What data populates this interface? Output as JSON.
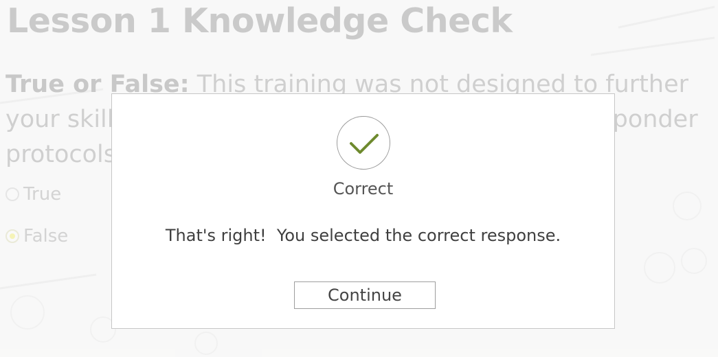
{
  "lesson": {
    "title": "Lesson 1 Knowledge Check"
  },
  "question": {
    "lead": "True or False:",
    "text": " This training was not designed to further your skills and knowledge of client service and responder protocols."
  },
  "options": [
    {
      "label": "True",
      "selected": false
    },
    {
      "label": "False",
      "selected": true
    }
  ],
  "feedback": {
    "icon": "checkmark-icon",
    "title": "Correct",
    "message": "That's right!  You selected the correct response.",
    "button_label": "Continue"
  },
  "colors": {
    "check_green": "#6e8a2e",
    "modal_border": "#c6c6c6",
    "selected_radio": "#f1ef9c"
  }
}
